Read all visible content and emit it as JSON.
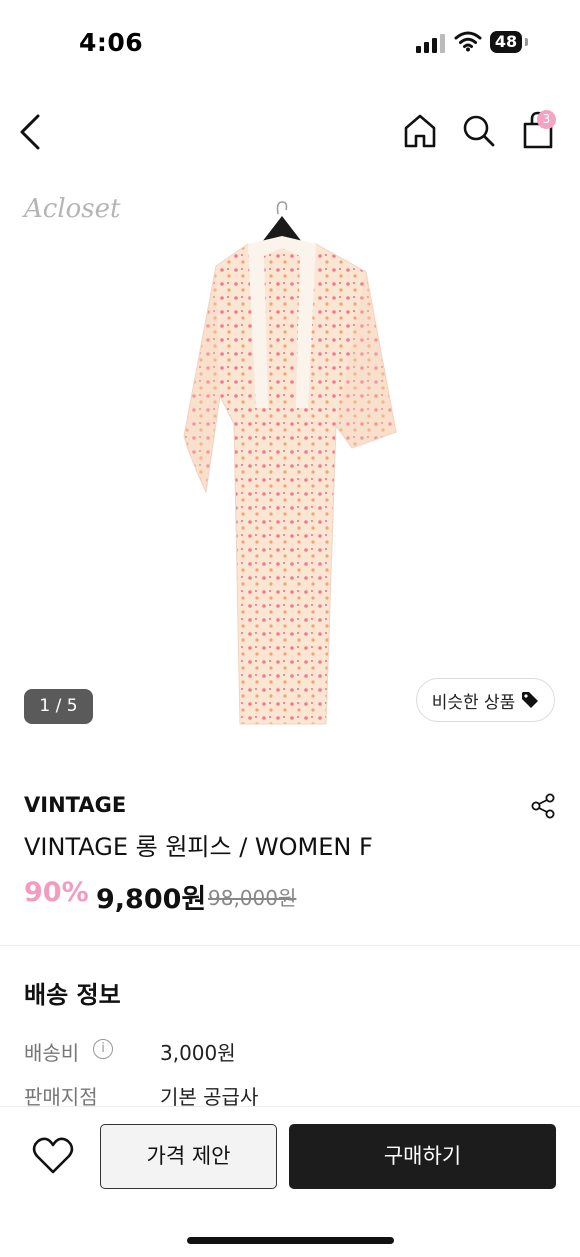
{
  "status": {
    "time": "4:06",
    "battery": "48"
  },
  "header": {
    "cart_count": "3"
  },
  "gallery": {
    "watermark": "Acloset",
    "counter": "1 / 5",
    "similar_label": "비슷한 상품"
  },
  "product": {
    "brand": "VINTAGE",
    "name": "VINTAGE 롱 원피스 / WOMEN F",
    "discount": "90%",
    "price": "9,800원",
    "original_price": "98,000원"
  },
  "shipping": {
    "title": "배송 정보",
    "rows": [
      {
        "label": "배송비",
        "value": "3,000원"
      },
      {
        "label": "판매지점",
        "value": "기본 공급사"
      }
    ]
  },
  "actions": {
    "offer_label": "가격 제안",
    "buy_label": "구매하기"
  },
  "colors": {
    "accent_pink": "#f29cc1",
    "badge_pink": "#f3a4c3",
    "dark": "#1c1c1c"
  }
}
